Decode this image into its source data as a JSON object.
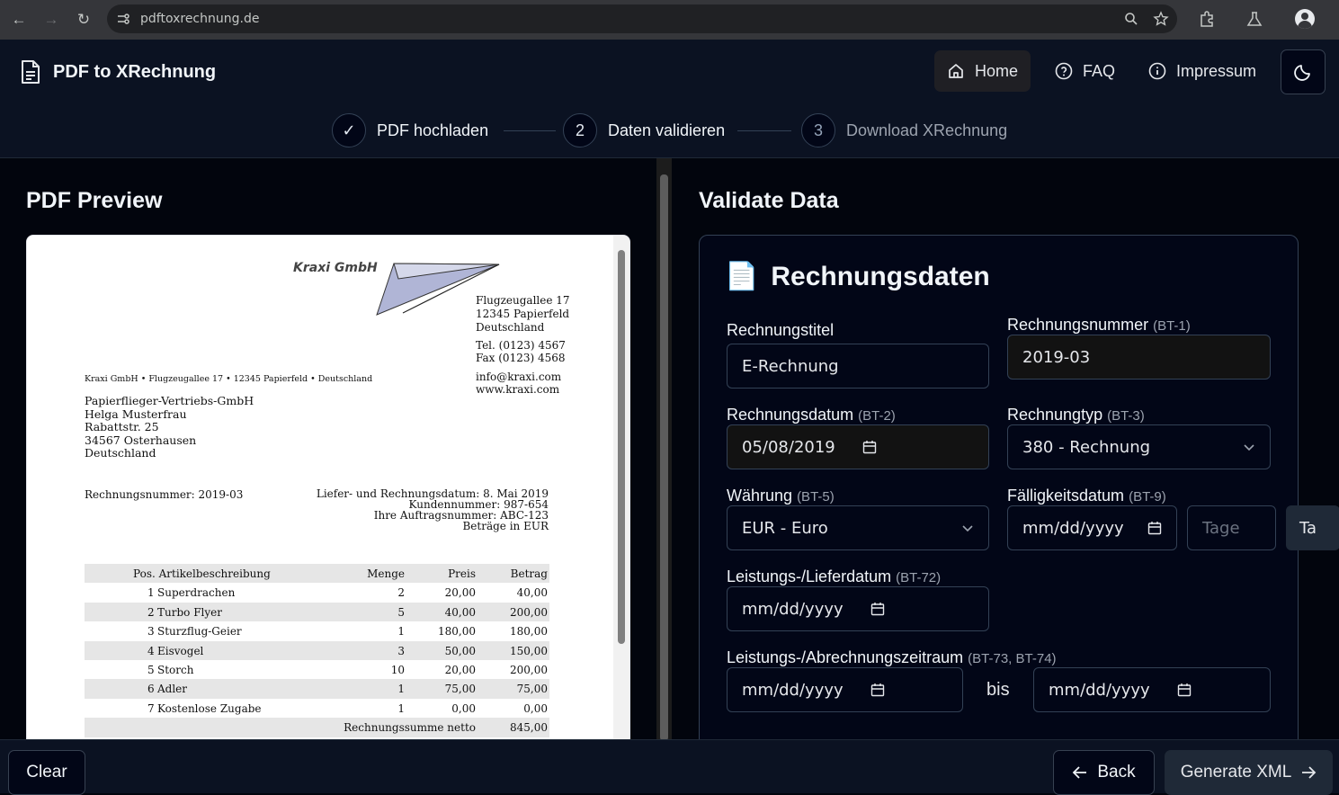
{
  "browser": {
    "url": "pdftoxrechnung.de"
  },
  "app": {
    "title": "PDF to XRechnung"
  },
  "nav": {
    "home": "Home",
    "faq": "FAQ",
    "impressum": "Impressum"
  },
  "steps": [
    {
      "num": "✓",
      "label": "PDF hochladen"
    },
    {
      "num": "2",
      "label": "Daten validieren"
    },
    {
      "num": "3",
      "label": "Download XRechnung"
    }
  ],
  "preview": {
    "title": "PDF Preview"
  },
  "pdf": {
    "company": "Kraxi GmbH",
    "addr": [
      "Flugzeugallee 17",
      "12345 Papierfeld",
      "Deutschland"
    ],
    "tel": "Tel. (0123) 4567",
    "fax": "Fax (0123) 4568",
    "email": "info@kraxi.com",
    "web": "www.kraxi.com",
    "sender": "Kraxi GmbH • Flugzeugallee 17 • 12345 Papierfeld • Deutschland",
    "recipient": [
      "Papierflieger-Vertriebs-GmbH",
      "Helga Musterfrau",
      "Rabattstr. 25",
      "34567 Osterhausen",
      "Deutschland"
    ],
    "invoice_no": "Rechnungsnummer: 2019-03",
    "meta": [
      "Liefer- und Rechnungsdatum: 8. Mai 2019",
      "Kundennummer: 987-654",
      "Ihre Auftragsnummer: ABC-123",
      "Beträge in EUR"
    ],
    "table_head": {
      "pos": "Pos. Artikelbeschreibung",
      "qty": "Menge",
      "price": "Preis",
      "amount": "Betrag"
    },
    "rows": [
      {
        "pos": "1",
        "desc": "Superdrachen",
        "qty": "2",
        "price": "20,00",
        "amount": "40,00"
      },
      {
        "pos": "2",
        "desc": "Turbo Flyer",
        "qty": "5",
        "price": "40,00",
        "amount": "200,00"
      },
      {
        "pos": "3",
        "desc": "Sturzflug-Geier",
        "qty": "1",
        "price": "180,00",
        "amount": "180,00"
      },
      {
        "pos": "4",
        "desc": "Eisvogel",
        "qty": "3",
        "price": "50,00",
        "amount": "150,00"
      },
      {
        "pos": "5",
        "desc": "Storch",
        "qty": "10",
        "price": "20,00",
        "amount": "200,00"
      },
      {
        "pos": "6",
        "desc": "Adler",
        "qty": "1",
        "price": "75,00",
        "amount": "75,00"
      },
      {
        "pos": "7",
        "desc": "Kostenlose Zugabe",
        "qty": "1",
        "price": "0,00",
        "amount": "0,00"
      }
    ],
    "net_label": "Rechnungssumme netto",
    "net_value": "845,00"
  },
  "validate": {
    "title": "Validate Data"
  },
  "form": {
    "section_title": "Rechnungsdaten",
    "section_icon": "📄",
    "titel_label": "Rechnungstitel",
    "titel_value": "E-Rechnung",
    "nummer_label": "Rechnungsnummer",
    "nummer_code": "(BT-1)",
    "nummer_value": "2019-03",
    "datum_label": "Rechnungsdatum",
    "datum_code": "(BT-2)",
    "datum_value": "05/08/2019",
    "typ_label": "Rechnungtyp",
    "typ_code": "(BT-3)",
    "typ_value": "380 - Rechnung",
    "waehrung_label": "Währung",
    "waehrung_code": "(BT-5)",
    "waehrung_value": "EUR - Euro",
    "faellig_label": "Fälligkeitsdatum",
    "faellig_code": "(BT-9)",
    "faellig_placeholder": "mm/dd/yyyy",
    "tage_placeholder": "Tage",
    "ta_cut": "Ta",
    "liefer_label": "Leistungs-/Lieferdatum",
    "liefer_code": "(BT-72)",
    "liefer_placeholder": "mm/dd/yyyy",
    "zeitraum_label": "Leistungs-/Abrechnungszeitraum",
    "zeitraum_code": "(BT-73, BT-74)",
    "zeitraum_from": "mm/dd/yyyy",
    "bis": "bis",
    "zeitraum_to": "mm/dd/yyyy"
  },
  "footer": {
    "clear": "Clear",
    "back": "Back",
    "generate": "Generate XML"
  }
}
